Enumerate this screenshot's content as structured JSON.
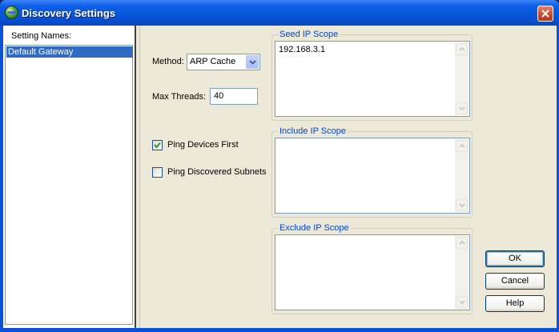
{
  "window": {
    "title": "Discovery Settings"
  },
  "settings_list": {
    "header": "Setting Names:",
    "items": [
      "Default Gateway"
    ],
    "selected_index": 0
  },
  "method": {
    "label": "Method:",
    "value": "ARP Cache"
  },
  "max_threads": {
    "label": "Max Threads:",
    "value": "40"
  },
  "ping_devices_first": {
    "label": "Ping Devices First",
    "checked": true
  },
  "ping_discovered_subnets": {
    "label": "Ping Discovered Subnets",
    "checked": false
  },
  "seed_scope": {
    "title": "Seed IP Scope",
    "value": "192.168.3.1"
  },
  "include_scope": {
    "title": "Include IP Scope",
    "value": ""
  },
  "exclude_scope": {
    "title": "Exclude IP Scope",
    "value": ""
  },
  "buttons": {
    "ok": "OK",
    "cancel": "Cancel",
    "help": "Help"
  },
  "icons": {
    "app": "network-globe-icon",
    "close": "close-icon",
    "dropdown": "chevron-down-icon",
    "check": "check-icon",
    "scroll_up": "scroll-up-arrow-icon",
    "scroll_down": "scroll-down-arrow-icon"
  },
  "colors": {
    "titlebar": "#0a55d7",
    "selection": "#316ac5",
    "group_title": "#0046d5",
    "dialog_bg": "#ece9d8"
  }
}
